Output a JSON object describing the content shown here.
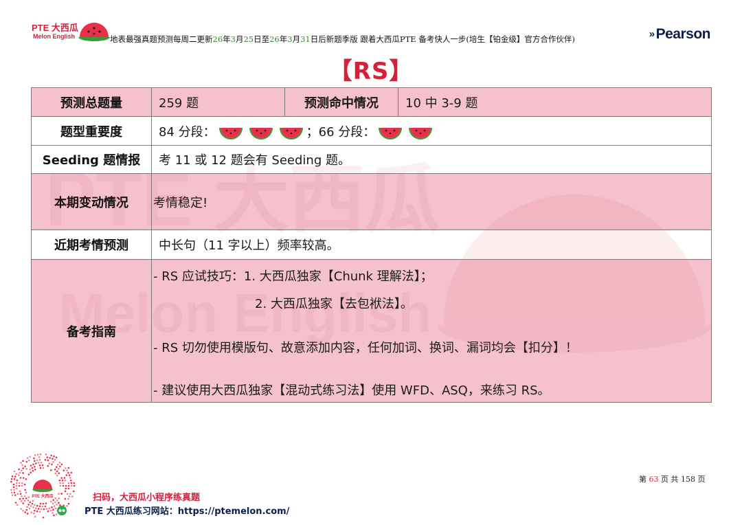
{
  "brand": {
    "pte_label": "PTE 大西瓜",
    "english_label": "Melon English"
  },
  "header": {
    "text_a": "地表最强真题预测每周二更新",
    "date1_year": "26",
    "t_year": "年",
    "date1_month": "3",
    "t_month": "月",
    "date1_day": "25",
    "t_day_to": "日至",
    "date2_year": "26",
    "date2_month": "3",
    "date2_day": "31",
    "text_b": "日后新题季版  跟着大西瓜PTE 备考快人一步(培生【铂金级】官方合作伙伴)",
    "partner_logo": "Pearson"
  },
  "title": "【RS】",
  "table": {
    "row1": {
      "label": "预测总题量",
      "value": "259 题",
      "label2": "预测命中情况",
      "value2": "10 中 3-9 题"
    },
    "row2": {
      "label": "题型重要度",
      "text_84": "84 分段：",
      "melons_84": 3,
      "sep": "；66 分段：",
      "melons_66": 2
    },
    "row3": {
      "label": "Seeding 题情报",
      "value": "考 11 或 12 题会有 Seeding 题。"
    },
    "row4": {
      "label": "本期变动情况",
      "value": "考情稳定!"
    },
    "row5": {
      "label": "近期考情预测",
      "value": "中长句（11 字以上）频率较高。"
    },
    "row6": {
      "label": "备考指南",
      "line1": "- RS 应试技巧：1.  大西瓜独家【Chunk 理解法】；",
      "line2": "2.  大西瓜独家【去包袱法】。",
      "line3": "- RS 切勿使用模版句、故意添加内容，任何加词、换词、漏词均会【扣分】！",
      "line4": "-   建议使用大西瓜独家【混动式练习法】使用 WFD、ASQ，来练习 RS。"
    }
  },
  "watermark": {
    "line1": "PTE 大西瓜",
    "line2": "Melon English"
  },
  "footer": {
    "qr_center_label": "PTE 大西瓜",
    "scan_text": "扫码，大西瓜小程序练真题",
    "site_text": "PTE 大西瓜练习网站：https://ptemelon.com/",
    "page_prefix": "第",
    "page_current": "63",
    "page_mid": "页  共",
    "page_total": "158",
    "page_suffix": "页"
  },
  "colors": {
    "accent_red": "#d6203a",
    "row_pink": "#f2b8c6",
    "melon_green": "#3a9a3a",
    "navy": "#0b1f4d"
  }
}
